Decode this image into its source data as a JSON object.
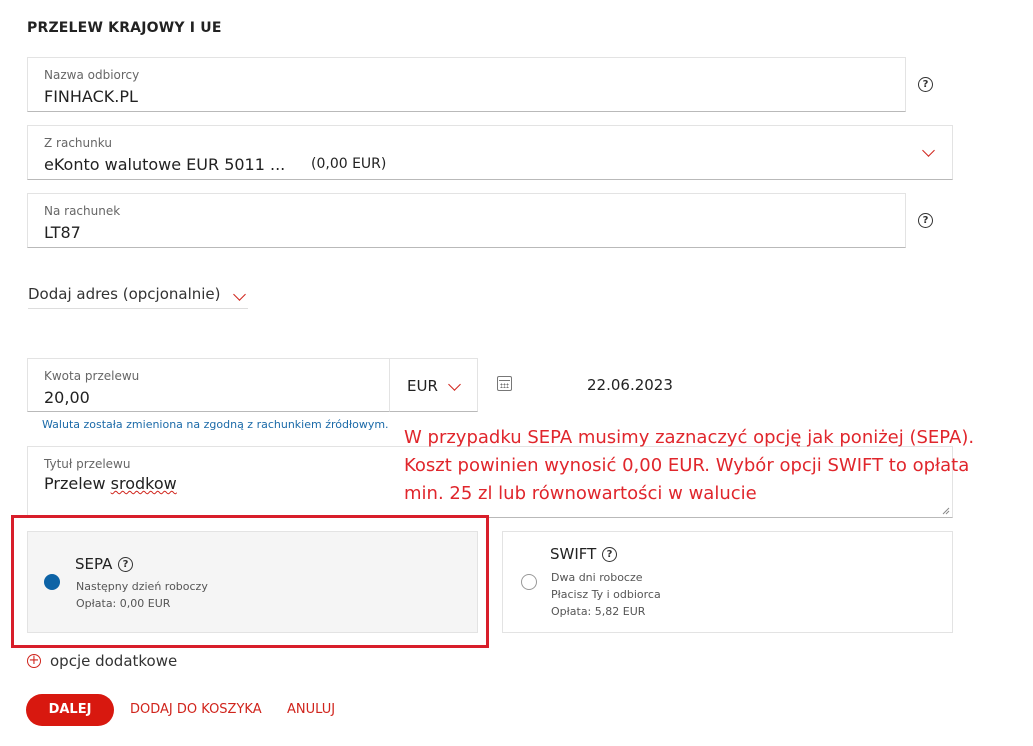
{
  "form": {
    "title": "PRZELEW KRAJOWY I UE",
    "recipient": {
      "label": "Nazwa odbiorcy",
      "value": "FINHACK.PL"
    },
    "from_account": {
      "label": "Z rachunku",
      "value": "eKonto walutowe EUR 5011 ...",
      "balance": "(0,00 EUR)"
    },
    "to_account": {
      "label": "Na rachunek",
      "value": "LT87"
    },
    "add_address": "Dodaj adres (opcjonalnie)",
    "amount": {
      "label": "Kwota przelewu",
      "value": "20,00",
      "currency": "EUR"
    },
    "date": "22.06.2023",
    "currency_hint": "Waluta została zmieniona na zgodną z rachunkiem źródłowym.",
    "transfer_title": {
      "label": "Tytuł przelewu",
      "value_word1": "Przelew",
      "value_word2": "srodkow"
    }
  },
  "annotation": {
    "lines": [
      "W przypadku SEPA musimy zaznaczyć opcję jak poniżej (SEPA).",
      "Koszt powinien wynosić 0,00 EUR. Wybór opcji SWIFT to opłata",
      "min. 25 zl lub równowartości w walucie"
    ],
    "color": "#e0262c"
  },
  "options": {
    "sepa": {
      "name": "SEPA",
      "line1": "Następny dzień roboczy",
      "line2": "Opłata: 0,00 EUR",
      "selected": true
    },
    "swift": {
      "name": "SWIFT",
      "line1": "Dwa dni robocze",
      "line2": "Płacisz Ty i odbiorca",
      "line3": "Opłata: 5,82 EUR",
      "selected": false
    }
  },
  "extra_options": "opcje dodatkowe",
  "actions": {
    "next": "DALEJ",
    "add_to_cart": "DODAJ DO KOSZYKA",
    "cancel": "ANULUJ"
  },
  "icons": {
    "help": "?",
    "plus": "+"
  },
  "colors": {
    "accent": "#d8180f",
    "radio_selected": "#0d63a6",
    "hint": "#1b6aa8"
  }
}
